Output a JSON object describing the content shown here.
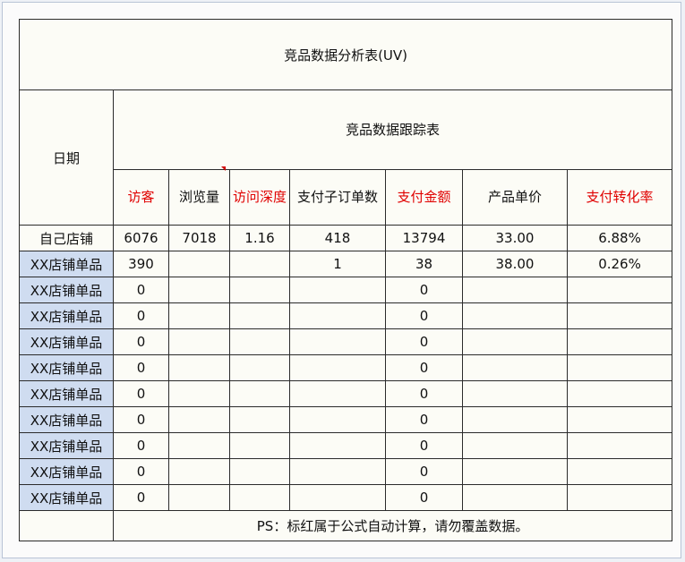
{
  "title": "竞品数据分析表(UV)",
  "date_label": "日期",
  "subtitle": "竞品数据跟踪表",
  "columns": [
    "访客",
    "浏览量",
    "访问深度",
    "支付子订单数",
    "支付金额",
    "产品单价",
    "支付转化率"
  ],
  "rows": [
    {
      "label": "自己店铺",
      "cells": [
        "6076",
        "7018",
        "1.16",
        "418",
        "13794",
        "33.00",
        "6.88%"
      ]
    },
    {
      "label": "XX店铺单品",
      "cells": [
        "390",
        "",
        "",
        "1",
        "38",
        "38.00",
        "0.26%"
      ]
    },
    {
      "label": "XX店铺单品",
      "cells": [
        "0",
        "",
        "",
        "",
        "0",
        "",
        ""
      ]
    },
    {
      "label": "XX店铺单品",
      "cells": [
        "0",
        "",
        "",
        "",
        "0",
        "",
        ""
      ]
    },
    {
      "label": "XX店铺单品",
      "cells": [
        "0",
        "",
        "",
        "",
        "0",
        "",
        ""
      ]
    },
    {
      "label": "XX店铺单品",
      "cells": [
        "0",
        "",
        "",
        "",
        "0",
        "",
        ""
      ]
    },
    {
      "label": "XX店铺单品",
      "cells": [
        "0",
        "",
        "",
        "",
        "0",
        "",
        ""
      ]
    },
    {
      "label": "XX店铺单品",
      "cells": [
        "0",
        "",
        "",
        "",
        "0",
        "",
        ""
      ]
    },
    {
      "label": "XX店铺单品",
      "cells": [
        "0",
        "",
        "",
        "",
        "0",
        "",
        ""
      ]
    },
    {
      "label": "XX店铺单品",
      "cells": [
        "0",
        "",
        "",
        "",
        "0",
        "",
        ""
      ]
    },
    {
      "label": "XX店铺单品",
      "cells": [
        "0",
        "",
        "",
        "",
        "0",
        "",
        ""
      ]
    }
  ],
  "note": "PS：标红属于公式自动计算，请勿覆盖数据。",
  "colors": {
    "title_bg": "#ff8c00",
    "header_bg": "#ffff00",
    "formula_red": "#e00000",
    "row_label_blue": "#cfdcf0"
  }
}
